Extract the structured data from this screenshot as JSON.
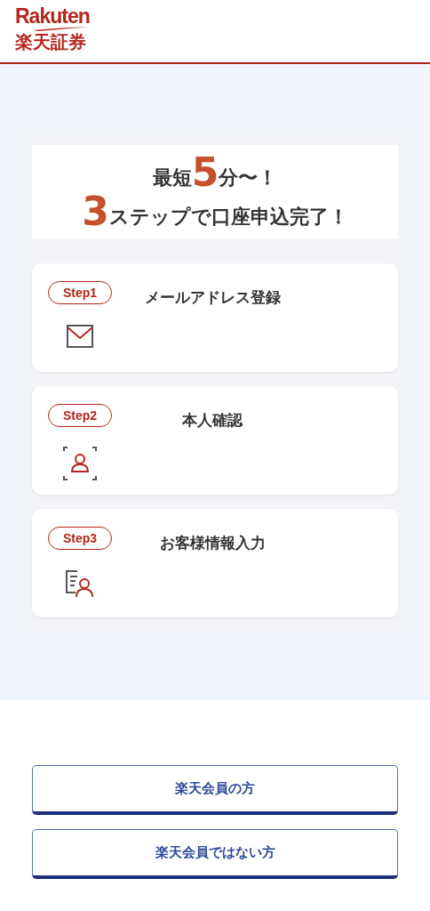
{
  "logo": {
    "wordmark": "Rakuten",
    "subtitle": "楽天証券"
  },
  "headline": {
    "lines": [
      [
        {
          "text": "最短",
          "big": false
        },
        {
          "text": "5",
          "big": true
        },
        {
          "text": "分〜！",
          "big": false
        }
      ],
      [
        {
          "text": "3",
          "big": true
        },
        {
          "text": "ステップで口座申込完了！",
          "big": false
        }
      ]
    ]
  },
  "steps": [
    {
      "badge": "Step1",
      "title": "メールアドレス登録",
      "kind": "mail"
    },
    {
      "badge": "Step2",
      "title": "本人確認",
      "kind": "identity"
    },
    {
      "badge": "Step3",
      "title": "お客様情報入力",
      "kind": "form"
    }
  ],
  "buttons": [
    "楽天会員の方",
    "楽天会員ではない方"
  ]
}
